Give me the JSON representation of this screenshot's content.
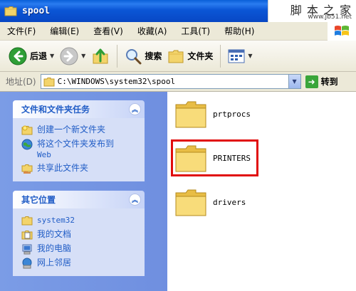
{
  "window": {
    "title": "spool",
    "watermark_main": "脚 本 之 家",
    "watermark_sub": "www.Jb51.net"
  },
  "menubar": {
    "items": [
      "文件(F)",
      "编辑(E)",
      "查看(V)",
      "收藏(A)",
      "工具(T)",
      "帮助(H)"
    ]
  },
  "toolbar": {
    "back_label": "后退",
    "search_label": "搜索",
    "folders_label": "文件夹"
  },
  "address": {
    "label": "地址(D)",
    "value": "C:\\WINDOWS\\system32\\spool",
    "go_label": "转到"
  },
  "taskpane": {
    "file_tasks": {
      "title": "文件和文件夹任务",
      "items": [
        "创建一个新文件夹",
        "将这个文件夹发布到",
        "Web",
        "共享此文件夹"
      ]
    },
    "other_places": {
      "title": "其它位置",
      "items": [
        "system32",
        "我的文档",
        "我的电脑",
        "网上邻居"
      ]
    }
  },
  "files": {
    "folders": [
      "prtprocs",
      "PRINTERS",
      "drivers"
    ],
    "highlighted": "PRINTERS"
  },
  "colors": {
    "titlebar": "#0b56d6",
    "taskpane": "#7b9ce6",
    "link": "#215dc6",
    "highlight": "#e10c0c"
  }
}
